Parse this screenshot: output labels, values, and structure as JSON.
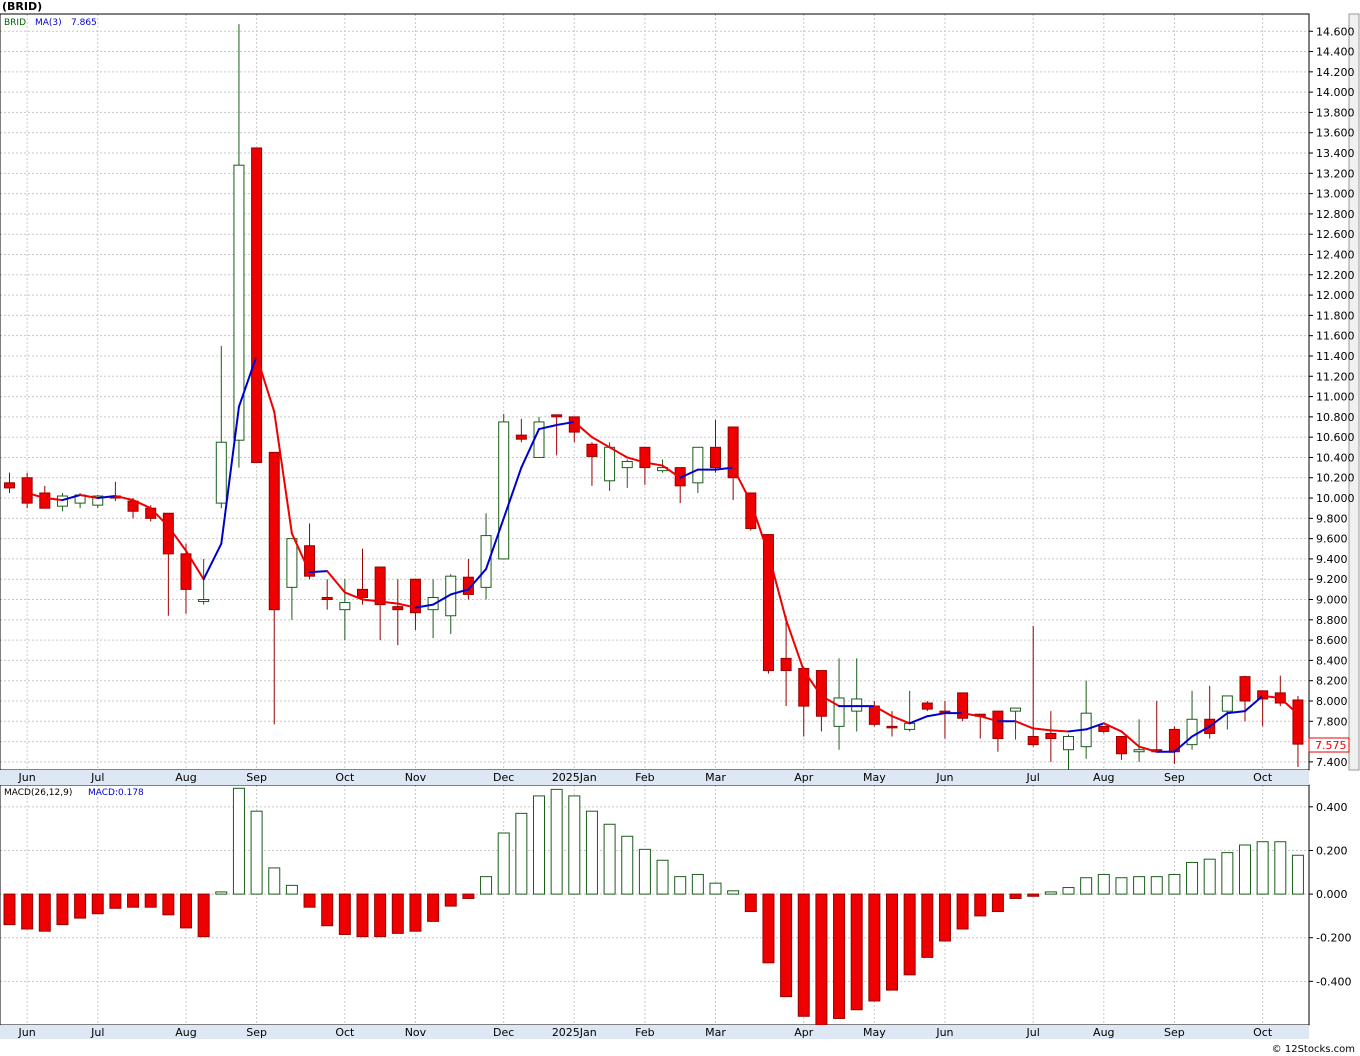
{
  "header": {
    "symbol_title": "(BRID)",
    "legend_symbol": "BRID",
    "legend_ma": "MA(3)",
    "legend_ma_value": "7.865",
    "macd_label": "MACD(26,12,9)",
    "macd_value_label": "MACD:0.178",
    "last_price_tag": "7.575",
    "footer": "© 12Stocks.com"
  },
  "colors": {
    "up_candle_fill": "#ffffff",
    "up_candle_stroke": "#1a5e1a",
    "down_candle_fill": "#ee0000",
    "ma_up": "#0000cc",
    "ma_down": "#ee0000",
    "grid": "#c8c8c8",
    "label_green": "#006400",
    "label_blue": "#0000cc"
  },
  "chart_data": [
    {
      "type": "candlestick",
      "title": "(BRID)",
      "ylim": [
        7.32,
        14.77
      ],
      "y_ticks": [
        "7.400",
        "7.600",
        "7.800",
        "8.000",
        "8.200",
        "8.400",
        "8.600",
        "8.800",
        "9.000",
        "9.200",
        "9.400",
        "9.600",
        "9.800",
        "10.000",
        "10.200",
        "10.400",
        "10.600",
        "10.800",
        "11.000",
        "11.200",
        "11.400",
        "11.600",
        "11.800",
        "12.000",
        "12.200",
        "12.400",
        "12.600",
        "12.800",
        "13.000",
        "13.200",
        "13.400",
        "13.600",
        "13.800",
        "14.000",
        "14.200",
        "14.400",
        "14.600"
      ],
      "x_ticks": [
        "Jun",
        "Jul",
        "Aug",
        "Sep",
        "Oct",
        "Nov",
        "Dec",
        "2025Jan",
        "Feb",
        "Mar",
        "Apr",
        "May",
        "Jun",
        "Jul",
        "Aug",
        "Sep",
        "Oct"
      ],
      "x_tick_bar_index": [
        1,
        5,
        10,
        14,
        19,
        23,
        28,
        32,
        36,
        40,
        45,
        49,
        53,
        58,
        62,
        66,
        71
      ],
      "grid": true,
      "last_price": 7.575,
      "candles": [
        {
          "o": 10.15,
          "h": 10.25,
          "l": 10.05,
          "c": 10.1
        },
        {
          "o": 10.2,
          "h": 10.25,
          "l": 9.9,
          "c": 9.95
        },
        {
          "o": 10.05,
          "h": 10.12,
          "l": 9.9,
          "c": 9.9
        },
        {
          "o": 9.92,
          "h": 10.05,
          "l": 9.87,
          "c": 10.02
        },
        {
          "o": 9.95,
          "h": 10.05,
          "l": 9.9,
          "c": 10.03
        },
        {
          "o": 9.93,
          "h": 10.03,
          "l": 9.9,
          "c": 10.02
        },
        {
          "o": 10.02,
          "h": 10.16,
          "l": 9.97,
          "c": 10.0
        },
        {
          "o": 9.97,
          "h": 10.0,
          "l": 9.8,
          "c": 9.87
        },
        {
          "o": 9.9,
          "h": 9.93,
          "l": 9.77,
          "c": 9.8
        },
        {
          "o": 9.85,
          "h": 9.85,
          "l": 8.84,
          "c": 9.45
        },
        {
          "o": 9.45,
          "h": 9.55,
          "l": 8.86,
          "c": 9.1
        },
        {
          "o": 8.98,
          "h": 9.4,
          "l": 8.95,
          "c": 9.0
        },
        {
          "o": 9.95,
          "h": 11.5,
          "l": 9.9,
          "c": 10.55
        },
        {
          "o": 10.57,
          "h": 14.67,
          "l": 10.3,
          "c": 13.28
        },
        {
          "o": 13.45,
          "h": 13.45,
          "l": 10.35,
          "c": 10.35
        },
        {
          "o": 10.45,
          "h": 10.45,
          "l": 7.77,
          "c": 8.9
        },
        {
          "o": 9.12,
          "h": 9.6,
          "l": 8.8,
          "c": 9.6
        },
        {
          "o": 9.53,
          "h": 9.75,
          "l": 9.2,
          "c": 9.23
        },
        {
          "o": 9.02,
          "h": 9.2,
          "l": 8.9,
          "c": 9.0
        },
        {
          "o": 8.9,
          "h": 9.2,
          "l": 8.6,
          "c": 8.97
        },
        {
          "o": 9.1,
          "h": 9.5,
          "l": 8.95,
          "c": 9.02
        },
        {
          "o": 9.32,
          "h": 9.32,
          "l": 8.6,
          "c": 8.95
        },
        {
          "o": 8.93,
          "h": 9.2,
          "l": 8.55,
          "c": 8.9
        },
        {
          "o": 9.2,
          "h": 9.2,
          "l": 8.7,
          "c": 8.87
        },
        {
          "o": 8.9,
          "h": 9.2,
          "l": 8.62,
          "c": 9.02
        },
        {
          "o": 8.84,
          "h": 9.25,
          "l": 8.66,
          "c": 9.23
        },
        {
          "o": 9.22,
          "h": 9.4,
          "l": 9.0,
          "c": 9.05
        },
        {
          "o": 9.12,
          "h": 9.85,
          "l": 9.0,
          "c": 9.63
        },
        {
          "o": 9.4,
          "h": 10.83,
          "l": 9.4,
          "c": 10.75
        },
        {
          "o": 10.62,
          "h": 10.78,
          "l": 10.55,
          "c": 10.58
        },
        {
          "o": 10.4,
          "h": 10.8,
          "l": 10.4,
          "c": 10.75
        },
        {
          "o": 10.82,
          "h": 10.82,
          "l": 10.42,
          "c": 10.8
        },
        {
          "o": 10.8,
          "h": 10.8,
          "l": 10.55,
          "c": 10.65
        },
        {
          "o": 10.53,
          "h": 10.55,
          "l": 10.12,
          "c": 10.41
        },
        {
          "o": 10.17,
          "h": 10.55,
          "l": 10.07,
          "c": 10.5
        },
        {
          "o": 10.3,
          "h": 10.38,
          "l": 10.1,
          "c": 10.36
        },
        {
          "o": 10.5,
          "h": 10.5,
          "l": 10.13,
          "c": 10.3
        },
        {
          "o": 10.27,
          "h": 10.38,
          "l": 10.25,
          "c": 10.3
        },
        {
          "o": 10.3,
          "h": 10.3,
          "l": 9.95,
          "c": 10.12
        },
        {
          "o": 10.15,
          "h": 10.5,
          "l": 10.05,
          "c": 10.5
        },
        {
          "o": 10.5,
          "h": 10.77,
          "l": 10.25,
          "c": 10.3
        },
        {
          "o": 10.7,
          "h": 10.7,
          "l": 9.98,
          "c": 10.2
        },
        {
          "o": 10.05,
          "h": 10.05,
          "l": 9.68,
          "c": 9.7
        },
        {
          "o": 9.64,
          "h": 9.64,
          "l": 8.27,
          "c": 8.3
        },
        {
          "o": 8.42,
          "h": 8.84,
          "l": 7.95,
          "c": 8.3
        },
        {
          "o": 8.32,
          "h": 8.34,
          "l": 7.65,
          "c": 7.95
        },
        {
          "o": 8.3,
          "h": 8.3,
          "l": 7.7,
          "c": 7.85
        },
        {
          "o": 7.75,
          "h": 8.42,
          "l": 7.52,
          "c": 8.03
        },
        {
          "o": 7.9,
          "h": 8.42,
          "l": 7.7,
          "c": 8.02
        },
        {
          "o": 7.95,
          "h": 8.0,
          "l": 7.75,
          "c": 7.77
        },
        {
          "o": 7.75,
          "h": 7.9,
          "l": 7.65,
          "c": 7.74
        },
        {
          "o": 7.72,
          "h": 8.1,
          "l": 7.7,
          "c": 7.78
        },
        {
          "o": 7.98,
          "h": 8.0,
          "l": 7.9,
          "c": 7.92
        },
        {
          "o": 7.9,
          "h": 8.0,
          "l": 7.63,
          "c": 7.88
        },
        {
          "o": 8.08,
          "h": 8.08,
          "l": 7.8,
          "c": 7.83
        },
        {
          "o": 7.87,
          "h": 7.87,
          "l": 7.63,
          "c": 7.85
        },
        {
          "o": 7.9,
          "h": 7.9,
          "l": 7.5,
          "c": 7.63
        },
        {
          "o": 7.9,
          "h": 7.93,
          "l": 7.62,
          "c": 7.93
        },
        {
          "o": 7.65,
          "h": 8.74,
          "l": 7.55,
          "c": 7.57
        },
        {
          "o": 7.68,
          "h": 7.9,
          "l": 7.4,
          "c": 7.63
        },
        {
          "o": 7.52,
          "h": 7.67,
          "l": 7.3,
          "c": 7.65
        },
        {
          "o": 7.55,
          "h": 8.2,
          "l": 7.43,
          "c": 7.88
        },
        {
          "o": 7.75,
          "h": 7.75,
          "l": 7.68,
          "c": 7.7
        },
        {
          "o": 7.65,
          "h": 7.65,
          "l": 7.42,
          "c": 7.48
        },
        {
          "o": 7.5,
          "h": 7.82,
          "l": 7.4,
          "c": 7.52
        },
        {
          "o": 7.52,
          "h": 8.0,
          "l": 7.52,
          "c": 7.5
        },
        {
          "o": 7.72,
          "h": 7.75,
          "l": 7.38,
          "c": 7.5
        },
        {
          "o": 7.57,
          "h": 8.1,
          "l": 7.52,
          "c": 7.82
        },
        {
          "o": 7.82,
          "h": 8.15,
          "l": 7.63,
          "c": 7.68
        },
        {
          "o": 7.9,
          "h": 8.05,
          "l": 7.72,
          "c": 8.05
        },
        {
          "o": 8.24,
          "h": 8.25,
          "l": 7.8,
          "c": 8.0
        },
        {
          "o": 8.1,
          "h": 8.1,
          "l": 7.75,
          "c": 8.02
        },
        {
          "o": 8.08,
          "h": 8.25,
          "l": 7.95,
          "c": 7.98
        },
        {
          "o": 8.01,
          "h": 8.05,
          "l": 7.35,
          "c": 7.575
        }
      ],
      "ma3": [
        null,
        10.05,
        10.0,
        9.98,
        10.03,
        10.0,
        10.02,
        9.98,
        9.9,
        9.72,
        9.48,
        9.2,
        9.55,
        10.9,
        11.4,
        10.85,
        9.65,
        9.27,
        9.28,
        9.07,
        9.0,
        8.98,
        8.96,
        8.92,
        8.95,
        9.05,
        9.1,
        9.3,
        9.8,
        10.3,
        10.68,
        10.72,
        10.75,
        10.6,
        10.5,
        10.4,
        10.35,
        10.32,
        10.2,
        10.28,
        10.28,
        10.3,
        9.96,
        9.45,
        8.8,
        8.3,
        8.05,
        7.95,
        7.95,
        7.95,
        7.85,
        7.78,
        7.85,
        7.88,
        7.88,
        7.85,
        7.8,
        7.8,
        7.73,
        7.71,
        7.7,
        7.72,
        7.78,
        7.7,
        7.55,
        7.5,
        7.5,
        7.65,
        7.75,
        7.88,
        7.9,
        8.05,
        8.03,
        7.87
      ],
      "ma3_direction": [
        "",
        "up",
        "down",
        "down",
        "up",
        "down",
        "up",
        "down",
        "down",
        "down",
        "down",
        "down",
        "up",
        "up",
        "up",
        "down",
        "down",
        "down",
        "up",
        "down",
        "down",
        "down",
        "down",
        "down",
        "up",
        "up",
        "up",
        "up",
        "up",
        "up",
        "up",
        "up",
        "up",
        "down",
        "down",
        "down",
        "down",
        "down",
        "down",
        "up",
        "up",
        "up",
        "down",
        "down",
        "down",
        "down",
        "down",
        "down",
        "down",
        "up",
        "down",
        "down",
        "up",
        "up",
        "up",
        "down",
        "down",
        "down",
        "down",
        "down",
        "down",
        "up",
        "up",
        "down",
        "down",
        "down",
        "up",
        "up",
        "up",
        "up",
        "up",
        "up",
        "down",
        "down"
      ]
    },
    {
      "type": "bar",
      "title": "MACD(26,12,9)",
      "ylim": [
        -0.6,
        0.5
      ],
      "y_ticks": [
        "-0.400",
        "-0.200",
        "0.000",
        "0.200",
        "0.400"
      ],
      "x_ticks": [
        "Jun",
        "Jul",
        "Aug",
        "Sep",
        "Oct",
        "Nov",
        "Dec",
        "2025Jan",
        "Feb",
        "Mar",
        "Apr",
        "May",
        "Jun",
        "Jul",
        "Aug",
        "Sep",
        "Oct"
      ],
      "values": [
        -0.14,
        -0.16,
        -0.17,
        -0.14,
        -0.11,
        -0.09,
        -0.065,
        -0.06,
        -0.06,
        -0.095,
        -0.155,
        -0.195,
        0.01,
        0.485,
        0.38,
        0.12,
        0.04,
        -0.06,
        -0.145,
        -0.185,
        -0.195,
        -0.195,
        -0.18,
        -0.17,
        -0.125,
        -0.055,
        -0.02,
        0.08,
        0.28,
        0.37,
        0.45,
        0.48,
        0.45,
        0.38,
        0.32,
        0.265,
        0.205,
        0.155,
        0.08,
        0.09,
        0.05,
        0.015,
        -0.08,
        -0.315,
        -0.47,
        -0.56,
        -0.6,
        -0.57,
        -0.53,
        -0.49,
        -0.44,
        -0.37,
        -0.29,
        -0.215,
        -0.16,
        -0.1,
        -0.08,
        -0.02,
        -0.01,
        0.01,
        0.03,
        0.075,
        0.09,
        0.075,
        0.08,
        0.08,
        0.09,
        0.145,
        0.16,
        0.19,
        0.225,
        0.24,
        0.24,
        0.178
      ]
    }
  ]
}
